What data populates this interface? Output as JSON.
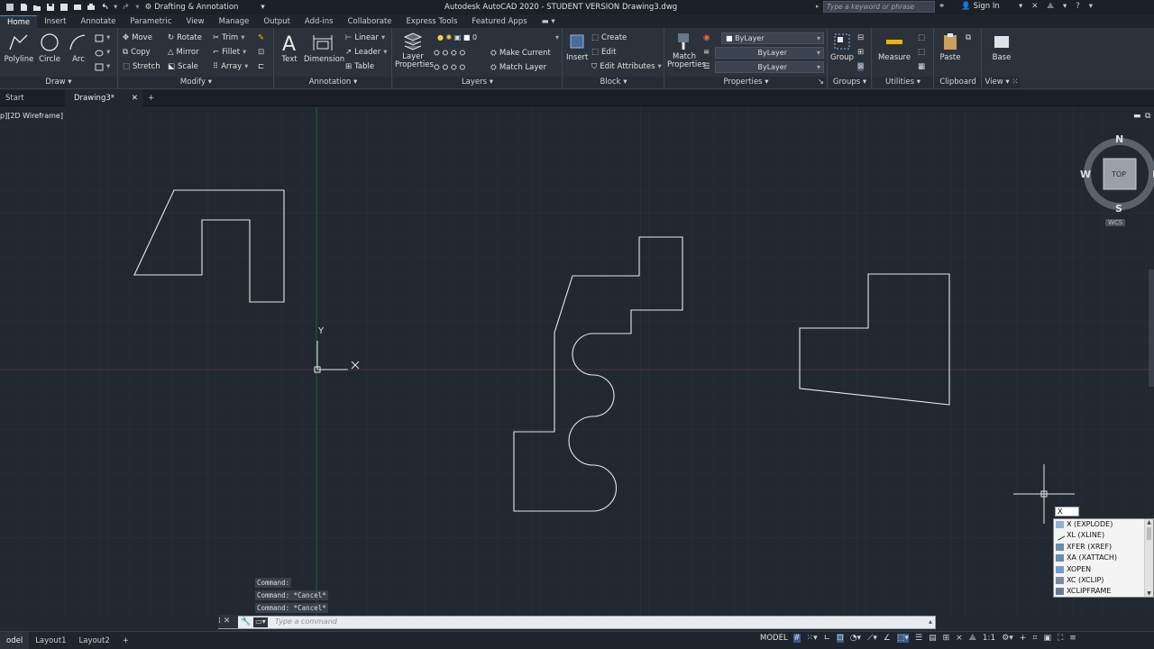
{
  "titlebar": {
    "workspace": "Drafting & Annotation",
    "title": "Autodesk AutoCAD 2020 - STUDENT VERSION    Drawing3.dwg",
    "search_placeholder": "Type a keyword or phrase",
    "signin": "Sign In"
  },
  "ribbon_tabs": [
    "Home",
    "Insert",
    "Annotate",
    "Parametric",
    "View",
    "Manage",
    "Output",
    "Add-ins",
    "Collaborate",
    "Express Tools",
    "Featured Apps"
  ],
  "panels": {
    "draw": {
      "title": "Draw",
      "polyline": "Polyline",
      "circle": "Circle",
      "arc": "Arc"
    },
    "modify": {
      "title": "Modify",
      "move": "Move",
      "rotate": "Rotate",
      "trim": "Trim",
      "copy": "Copy",
      "mirror": "Mirror",
      "fillet": "Fillet",
      "stretch": "Stretch",
      "scale": "Scale",
      "array": "Array"
    },
    "annotation": {
      "title": "Annotation",
      "text": "Text",
      "dimension": "Dimension",
      "linear": "Linear",
      "leader": "Leader",
      "table": "Table"
    },
    "layers": {
      "title": "Layers",
      "layer_properties": "Layer\nProperties",
      "layer_value": "0",
      "make_current": "Make Current",
      "match_layer": "Match Layer"
    },
    "block": {
      "title": "Block",
      "insert": "Insert",
      "create": "Create",
      "edit": "Edit",
      "edit_attributes": "Edit Attributes"
    },
    "properties": {
      "title": "Properties",
      "match_properties": "Match\nProperties",
      "color": "ByLayer",
      "linetype": "ByLayer",
      "lineweight": "ByLayer"
    },
    "groups": {
      "title": "Groups",
      "group": "Group"
    },
    "utilities": {
      "title": "Utilities",
      "measure": "Measure"
    },
    "clipboard": {
      "title": "Clipboard",
      "paste": "Paste"
    },
    "view": {
      "title": "View",
      "base": "Base"
    }
  },
  "file_tabs": {
    "start": "Start",
    "drawing": "Drawing3*"
  },
  "viewport_label": "p][2D Wireframe]",
  "viewcube": {
    "n": "N",
    "s": "S",
    "w": "W",
    "e": "E",
    "top": "TOP",
    "wcs": "WCS"
  },
  "ucs": {
    "x": "X",
    "y": "Y"
  },
  "command_history": [
    "Command:",
    "Command: *Cancel*",
    "Command: *Cancel*"
  ],
  "command_placeholder": "Type a command",
  "autocomplete": {
    "typed": "X",
    "items": [
      "X (EXPLODE)",
      "XL (XLINE)",
      "XFER (XREF)",
      "XA (XATTACH)",
      "XOPEN",
      "XC (XCLIP)",
      "XCLIPFRAME"
    ]
  },
  "layout_tabs": [
    "odel",
    "Layout1",
    "Layout2"
  ],
  "status": {
    "model": "MODEL",
    "scale": "1:1"
  },
  "colors": {
    "canvas": "#212830",
    "ribbon": "#2b323c",
    "accent": "#3d8fd1",
    "geometry": "#e8e8e8"
  }
}
